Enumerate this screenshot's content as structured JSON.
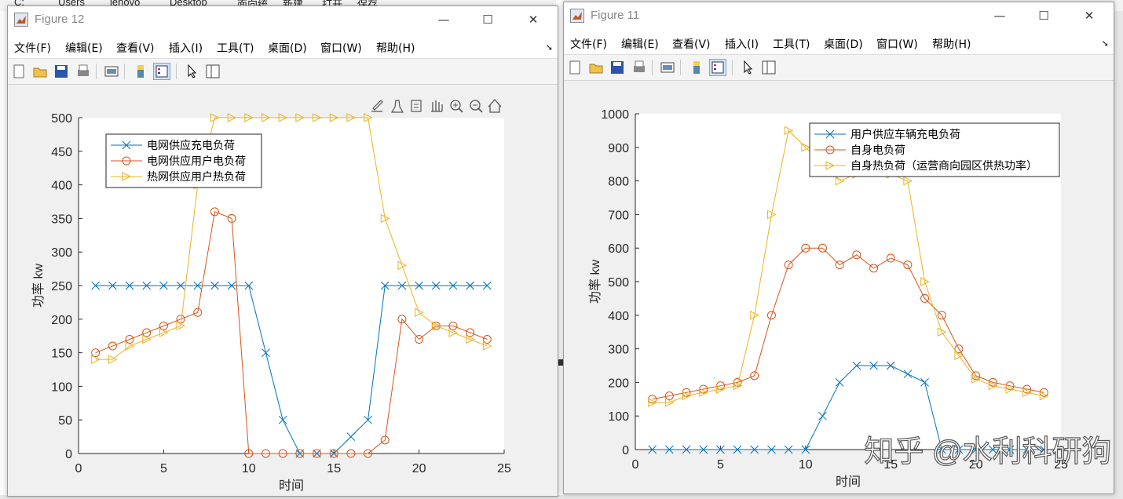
{
  "background": {
    "path_fragments": [
      "C:",
      "Users",
      "lenovo",
      "Desktop",
      "面向统"
    ],
    "middle_fragments": [
      "新建",
      "打开",
      "保存"
    ]
  },
  "menu": [
    "文件(F)",
    "编辑(E)",
    "查看(V)",
    "插入(I)",
    "工具(T)",
    "桌面(D)",
    "窗口(W)",
    "帮助(H)"
  ],
  "window_controls": {
    "minimize": "—",
    "maximize": "☐",
    "close": "✕"
  },
  "colors": {
    "series1": "#0072BD",
    "series2": "#D95319",
    "series3": "#EDB120"
  },
  "figure12": {
    "title": "Figure 12",
    "chart_data": {
      "type": "line",
      "xlabel": "时间",
      "ylabel": "功率 kw",
      "xlim": [
        0,
        25
      ],
      "ylim": [
        0,
        500
      ],
      "xticks": [
        0,
        5,
        10,
        15,
        20,
        25
      ],
      "yticks": [
        0,
        50,
        100,
        150,
        200,
        250,
        300,
        350,
        400,
        450,
        500
      ],
      "legend_position": "top-left",
      "x": [
        1,
        2,
        3,
        4,
        5,
        6,
        7,
        8,
        9,
        10,
        11,
        12,
        13,
        14,
        15,
        16,
        17,
        18,
        19,
        20,
        21,
        22,
        23,
        24
      ],
      "series": [
        {
          "name": "电网供应充电负荷",
          "marker": "x",
          "color": "#0072BD",
          "values": [
            250,
            250,
            250,
            250,
            250,
            250,
            250,
            250,
            250,
            250,
            150,
            50,
            0,
            0,
            0,
            25,
            50,
            250,
            250,
            250,
            250,
            250,
            250,
            250
          ]
        },
        {
          "name": "电网供应用户电负荷",
          "marker": "o",
          "color": "#D95319",
          "values": [
            150,
            160,
            170,
            180,
            190,
            200,
            210,
            360,
            350,
            0,
            0,
            0,
            0,
            0,
            0,
            0,
            0,
            20,
            200,
            170,
            190,
            190,
            180,
            170
          ]
        },
        {
          "name": "热网供应用户热负荷",
          "marker": ">",
          "color": "#EDB120",
          "values": [
            140,
            140,
            160,
            170,
            180,
            190,
            400,
            500,
            500,
            500,
            500,
            500,
            500,
            500,
            500,
            500,
            500,
            350,
            280,
            210,
            190,
            180,
            170,
            160
          ]
        }
      ]
    }
  },
  "figure11": {
    "title": "Figure 11",
    "chart_data": {
      "type": "line",
      "xlabel": "时间",
      "ylabel": "功率 kw",
      "xlim": [
        0,
        25
      ],
      "ylim": [
        0,
        1000
      ],
      "xticks": [
        0,
        5,
        10,
        15,
        20,
        25
      ],
      "yticks": [
        0,
        100,
        200,
        300,
        400,
        500,
        600,
        700,
        800,
        900,
        1000
      ],
      "legend_position": "top-right",
      "x": [
        1,
        2,
        3,
        4,
        5,
        6,
        7,
        8,
        9,
        10,
        11,
        12,
        13,
        14,
        15,
        16,
        17,
        18,
        19,
        20,
        21,
        22,
        23,
        24
      ],
      "series": [
        {
          "name": "用户供应车辆充电负荷",
          "marker": "x",
          "color": "#0072BD",
          "values": [
            0,
            0,
            0,
            0,
            0,
            0,
            0,
            0,
            0,
            0,
            100,
            200,
            250,
            250,
            250,
            225,
            200,
            0,
            0,
            0,
            0,
            0,
            0,
            0
          ]
        },
        {
          "name": "自身电负荷",
          "marker": "o",
          "color": "#D95319",
          "values": [
            150,
            160,
            170,
            180,
            190,
            200,
            220,
            400,
            550,
            600,
            600,
            550,
            580,
            540,
            570,
            550,
            450,
            400,
            300,
            220,
            200,
            190,
            180,
            170
          ]
        },
        {
          "name": "自身热负荷（运营商向园区供热功率）",
          "marker": ">",
          "color": "#EDB120",
          "values": [
            140,
            140,
            160,
            170,
            180,
            190,
            400,
            700,
            950,
            900,
            850,
            800,
            820,
            860,
            820,
            800,
            500,
            350,
            280,
            210,
            190,
            180,
            170,
            160
          ]
        }
      ]
    }
  },
  "watermark": "知乎 @水利科研狗"
}
